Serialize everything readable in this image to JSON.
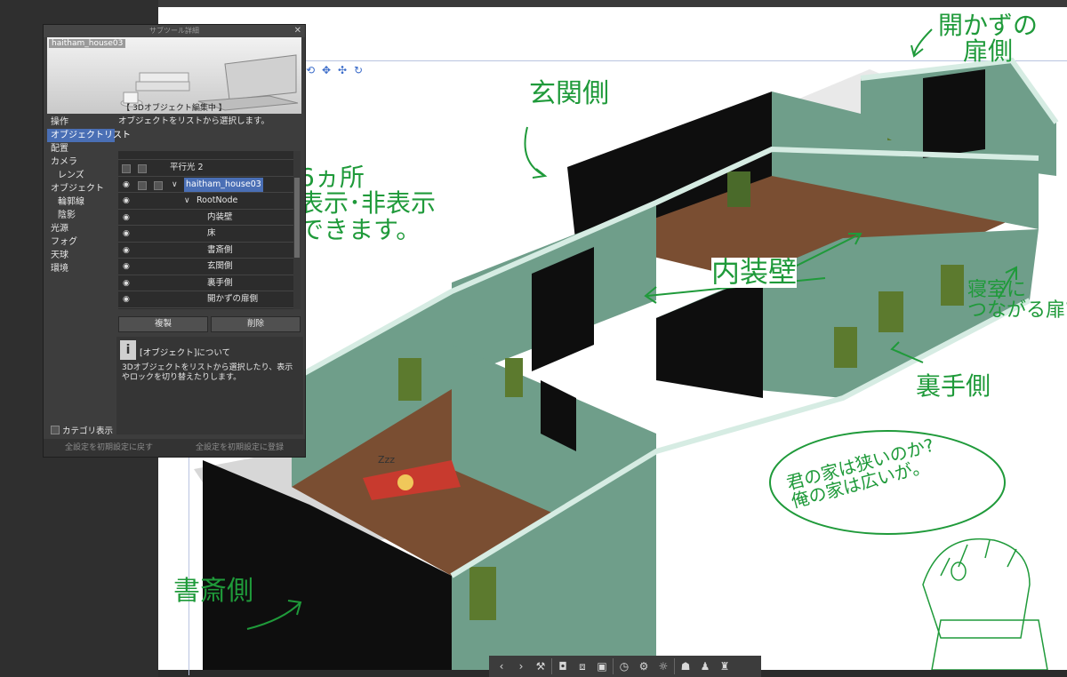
{
  "panel": {
    "title": "サブツール詳細",
    "preview_name": "haitham_house03",
    "preview_status": "【 3Dオブジェクト編集中 】",
    "menu": [
      "操作",
      "オブジェクトリスト",
      "配置",
      "カメラ",
      "レンズ",
      "オブジェクト",
      "輪郭線",
      "陰影",
      "光源",
      "フォグ",
      "天球",
      "環境"
    ],
    "active_menu": "オブジェクトリスト",
    "description": "オブジェクトをリストから選択します。",
    "list_rows": [
      {
        "label": "平行光 2"
      },
      {
        "label": "haitham_house03"
      },
      {
        "label": "RootNode"
      },
      {
        "label": "内装壁"
      },
      {
        "label": "床"
      },
      {
        "label": "書斎側"
      },
      {
        "label": "玄関側"
      },
      {
        "label": "裏手側"
      },
      {
        "label": "開かずの扉側"
      }
    ],
    "duplicate_button": "複製",
    "delete_button": "削除",
    "info_title": "[オブジェクト]について",
    "info_text": "3Dオブジェクトをリストから選択したり、表示やロックを切り替えたりします。",
    "category_toggle": "カテゴリ表示",
    "reset_button": "全設定を初期設定に戻す",
    "register_button": "全設定を初期設定に登録"
  },
  "annotations": {
    "genkan": "玄関側",
    "akazu": "開かずの\n扉側",
    "six": "6ヵ所\n表示･非表示\nできます。",
    "naisou": "内装壁",
    "shinshitsu": "寝室に\nつながる扉??",
    "urate": "裏手側",
    "shosai": "書斎側",
    "bubble": "君の家は狭いのか?\n俺の家は広いが。",
    "zzz": "Zzz"
  },
  "colors": {
    "wall": "#6f9e8a",
    "wall_dark": "#0e0e0e",
    "trim": "#d6ece3",
    "floor": "#7a4e32",
    "annotation": "#1f9a3a",
    "selection": "#4a6fb5"
  }
}
